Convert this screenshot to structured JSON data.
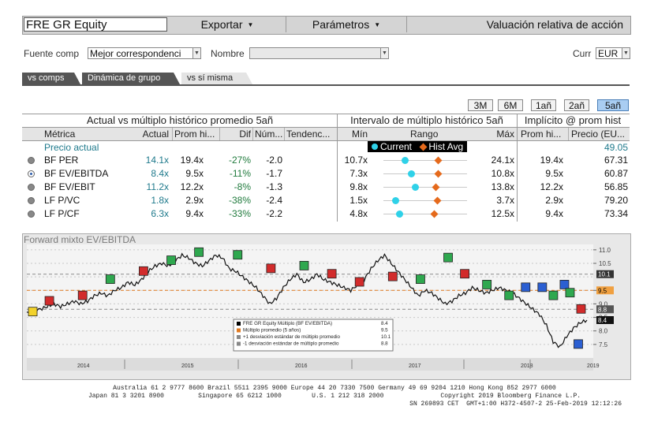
{
  "toolbar": {
    "ticker": "FRE GR Equity",
    "export": "Exportar",
    "params": "Parámetros",
    "title": "Valuación relativa de acción"
  },
  "source": {
    "label": "Fuente comp",
    "value": "Mejor correspondenci",
    "name_label": "Nombre",
    "name_value": "",
    "curr_label": "Curr",
    "curr_value": "EUR"
  },
  "tabs": [
    "vs comps",
    "Dinámica de grupo",
    "vs sí misma"
  ],
  "periods": [
    "3M",
    "6M",
    "1añ",
    "2añ",
    "5añ"
  ],
  "table": {
    "group1": "Actual vs múltiplo histórico promedio 5añ",
    "group2": "Intervalo de múltiplo histórico 5añ",
    "group3": "Implícito @ prom hist",
    "cols": [
      "Métrica",
      "Actual",
      "Prom hi...",
      "Dif",
      "Núm...",
      "Tendenc...",
      "Mín",
      "Rango",
      "Máx",
      "Prom hi...",
      "Precio (EU..."
    ],
    "legend_current": "Current",
    "legend_avg": "Hist Avg",
    "price_label": "Precio actual",
    "price_value": "49.05",
    "rows": [
      {
        "metric": "BF PER",
        "actual": "14.1x",
        "avg": "19.4x",
        "dif": "-27%",
        "num": "-2.0",
        "min": "10.7x",
        "max": "24.1x",
        "iavg": "19.4x",
        "price": "67.31",
        "cur": 0.25,
        "havg": 0.65,
        "selected": false
      },
      {
        "metric": "BF EV/EBITDA",
        "actual": "8.4x",
        "avg": "9.5x",
        "dif": "-11%",
        "num": "-1.7",
        "min": "7.3x",
        "max": "10.8x",
        "iavg": "9.5x",
        "price": "60.87",
        "cur": 0.33,
        "havg": 0.65,
        "selected": true
      },
      {
        "metric": "BF EV/EBIT",
        "actual": "11.2x",
        "avg": "12.2x",
        "dif": "-8%",
        "num": "-1.3",
        "min": "9.8x",
        "max": "13.8x",
        "iavg": "12.2x",
        "price": "56.85",
        "cur": 0.38,
        "havg": 0.62,
        "selected": false
      },
      {
        "metric": "LF P/VC",
        "actual": "1.8x",
        "avg": "2.9x",
        "dif": "-38%",
        "num": "-2.4",
        "min": "1.5x",
        "max": "3.7x",
        "iavg": "2.9x",
        "price": "79.20",
        "cur": 0.14,
        "havg": 0.64,
        "selected": false
      },
      {
        "metric": "LF P/CF",
        "actual": "6.3x",
        "avg": "9.4x",
        "dif": "-33%",
        "num": "-2.2",
        "min": "4.8x",
        "max": "12.5x",
        "iavg": "9.4x",
        "price": "73.34",
        "cur": 0.19,
        "havg": 0.6,
        "selected": false
      }
    ]
  },
  "chart_data": {
    "type": "line",
    "title": "Forward mixto EV/EBITDA",
    "x_labels": [
      "2014",
      "2015",
      "2016",
      "2017",
      "2018",
      "2019"
    ],
    "ylim": [
      7.0,
      11.2
    ],
    "yticks": [
      "11.0",
      "10.5",
      "9.5",
      "9.0",
      "8.5",
      "8.0",
      "7.5"
    ],
    "tag_values": [
      "10.1",
      "9.5",
      "8.8",
      "8.4"
    ],
    "series": [
      {
        "name": "FRE GR Equity Múltiplo (BF EV/EBITDA)",
        "last": "8.4",
        "color": "#000000",
        "values": [
          8.7,
          8.8,
          8.8,
          8.9,
          9.0,
          8.9,
          9.0,
          9.1,
          9.0,
          9.1,
          9.3,
          9.4,
          9.3,
          9.5,
          9.6,
          9.8,
          9.7,
          9.9,
          10.2,
          10.4,
          10.5,
          10.4,
          10.6,
          10.8,
          10.7,
          10.5,
          10.4,
          10.6,
          10.8,
          10.7,
          10.3,
          10.2,
          10.0,
          9.8,
          9.6,
          9.3,
          9.0,
          9.2,
          9.6,
          9.9,
          10.1,
          9.8,
          9.9,
          10.1,
          9.9,
          9.8,
          9.7,
          9.6,
          9.5,
          9.7,
          9.9,
          10.3,
          10.6,
          10.8,
          10.5,
          10.2,
          9.9,
          9.6,
          9.3,
          9.5,
          9.4,
          9.2,
          9.0,
          9.1,
          9.3,
          9.4,
          9.6,
          9.5,
          9.4,
          9.5,
          9.6,
          9.5,
          9.4,
          9.2,
          9.0,
          8.8,
          8.6,
          8.2,
          7.6,
          7.4,
          7.8,
          8.1,
          8.3,
          8.4
        ]
      },
      {
        "name": "Múltiplo promedio (5 años)",
        "last": "9.5",
        "color": "#e07a20"
      },
      {
        "name": "+1 desviación estándar de múltiplo promedio",
        "last": "10.1",
        "color": "#888888"
      },
      {
        "name": "-1 desviación estándar de múltiplo promedio",
        "last": "8.8",
        "color": "#888888"
      }
    ],
    "mean": 9.5,
    "plus1": 10.1,
    "minus1": 8.8,
    "markers": [
      {
        "t": 0.01,
        "v": 8.7,
        "c": "yellow"
      },
      {
        "t": 0.04,
        "v": 9.1,
        "c": "red"
      },
      {
        "t": 0.1,
        "v": 9.3,
        "c": "red"
      },
      {
        "t": 0.15,
        "v": 9.9,
        "c": "green"
      },
      {
        "t": 0.21,
        "v": 10.2,
        "c": "red"
      },
      {
        "t": 0.26,
        "v": 10.6,
        "c": "green"
      },
      {
        "t": 0.31,
        "v": 10.9,
        "c": "green"
      },
      {
        "t": 0.38,
        "v": 10.8,
        "c": "green"
      },
      {
        "t": 0.44,
        "v": 10.3,
        "c": "red"
      },
      {
        "t": 0.5,
        "v": 10.4,
        "c": "green"
      },
      {
        "t": 0.55,
        "v": 10.1,
        "c": "red"
      },
      {
        "t": 0.6,
        "v": 9.8,
        "c": "red"
      },
      {
        "t": 0.66,
        "v": 10.0,
        "c": "red"
      },
      {
        "t": 0.71,
        "v": 9.9,
        "c": "green"
      },
      {
        "t": 0.76,
        "v": 10.7,
        "c": "green"
      },
      {
        "t": 0.79,
        "v": 10.1,
        "c": "red"
      },
      {
        "t": 0.83,
        "v": 9.7,
        "c": "green"
      },
      {
        "t": 0.87,
        "v": 9.3,
        "c": "green"
      },
      {
        "t": 0.9,
        "v": 9.6,
        "c": "blue"
      },
      {
        "t": 0.93,
        "v": 9.6,
        "c": "blue"
      },
      {
        "t": 0.95,
        "v": 9.3,
        "c": "green"
      },
      {
        "t": 0.97,
        "v": 9.7,
        "c": "blue"
      },
      {
        "t": 0.98,
        "v": 9.4,
        "c": "green"
      },
      {
        "t": 0.995,
        "v": 7.5,
        "c": "blue"
      },
      {
        "t": 1.0,
        "v": 8.8,
        "c": "red"
      }
    ]
  },
  "footer": {
    "line1": "Australia 61 2 9777 8600 Brazil 5511 2395 9000 Europe 44 20 7330 7500 Germany 49 69 9204 1210 Hong Kong 852 2977 6000",
    "line2": "Japan 81 3 3201 8900         Singapore 65 6212 1000        U.S. 1 212 318 2000               Copyright 2019 Bloomberg Finance L.P.",
    "line3": "SN 269893 CET  GMT+1:00 H372-4507-2 25-Feb-2019 12:12:26"
  },
  "colors": {
    "accent": "#a9cdf2",
    "teal": "#1f7a8c",
    "green": "#1f7a3c",
    "orange": "#e56a1c",
    "cyan": "#2fd1e8"
  }
}
